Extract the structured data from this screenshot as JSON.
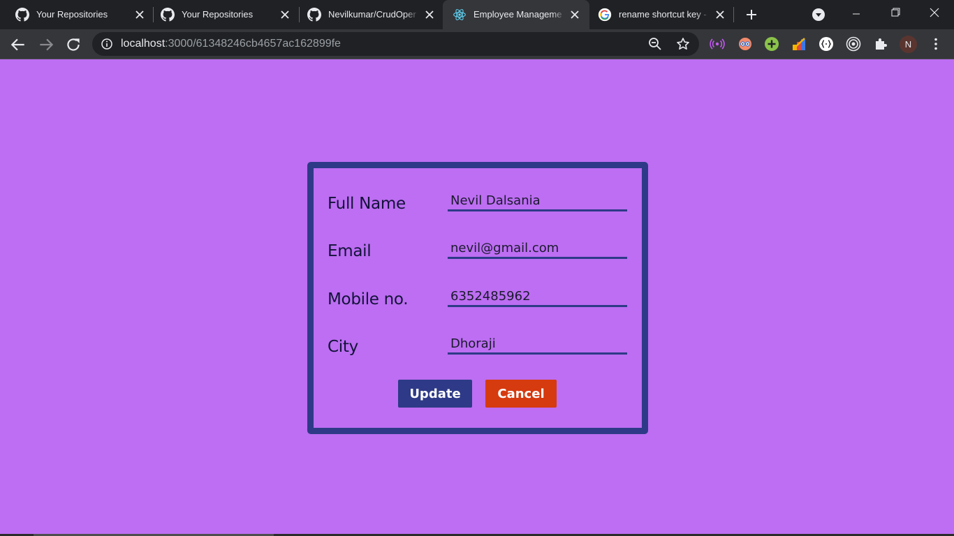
{
  "browser": {
    "tabs": [
      {
        "title": "Your Repositories",
        "icon": "github-icon"
      },
      {
        "title": "Your Repositories",
        "icon": "github-icon"
      },
      {
        "title": "Nevilkumar/CrudOper",
        "icon": "github-icon"
      },
      {
        "title": "Employee Manageme",
        "icon": "react-icon",
        "active": true
      },
      {
        "title": "rename shortcut key -",
        "icon": "google-icon"
      }
    ],
    "url_host": "localhost",
    "url_path": ":3000/61348246cb4657ac162899fe",
    "profile_initial": "N"
  },
  "form": {
    "fields": [
      {
        "label": "Full Name",
        "value": "Nevil Dalsania"
      },
      {
        "label": "Email",
        "value": "nevil@gmail.com"
      },
      {
        "label": "Mobile no.",
        "value": "6352485962"
      },
      {
        "label": "City",
        "value": "Dhoraji"
      }
    ],
    "update_label": "Update",
    "cancel_label": "Cancel"
  },
  "colors": {
    "page_background": "#bd6ef2",
    "card_border": "#2e3a87",
    "update_button": "#2e3a87",
    "cancel_button": "#d63a0f"
  }
}
